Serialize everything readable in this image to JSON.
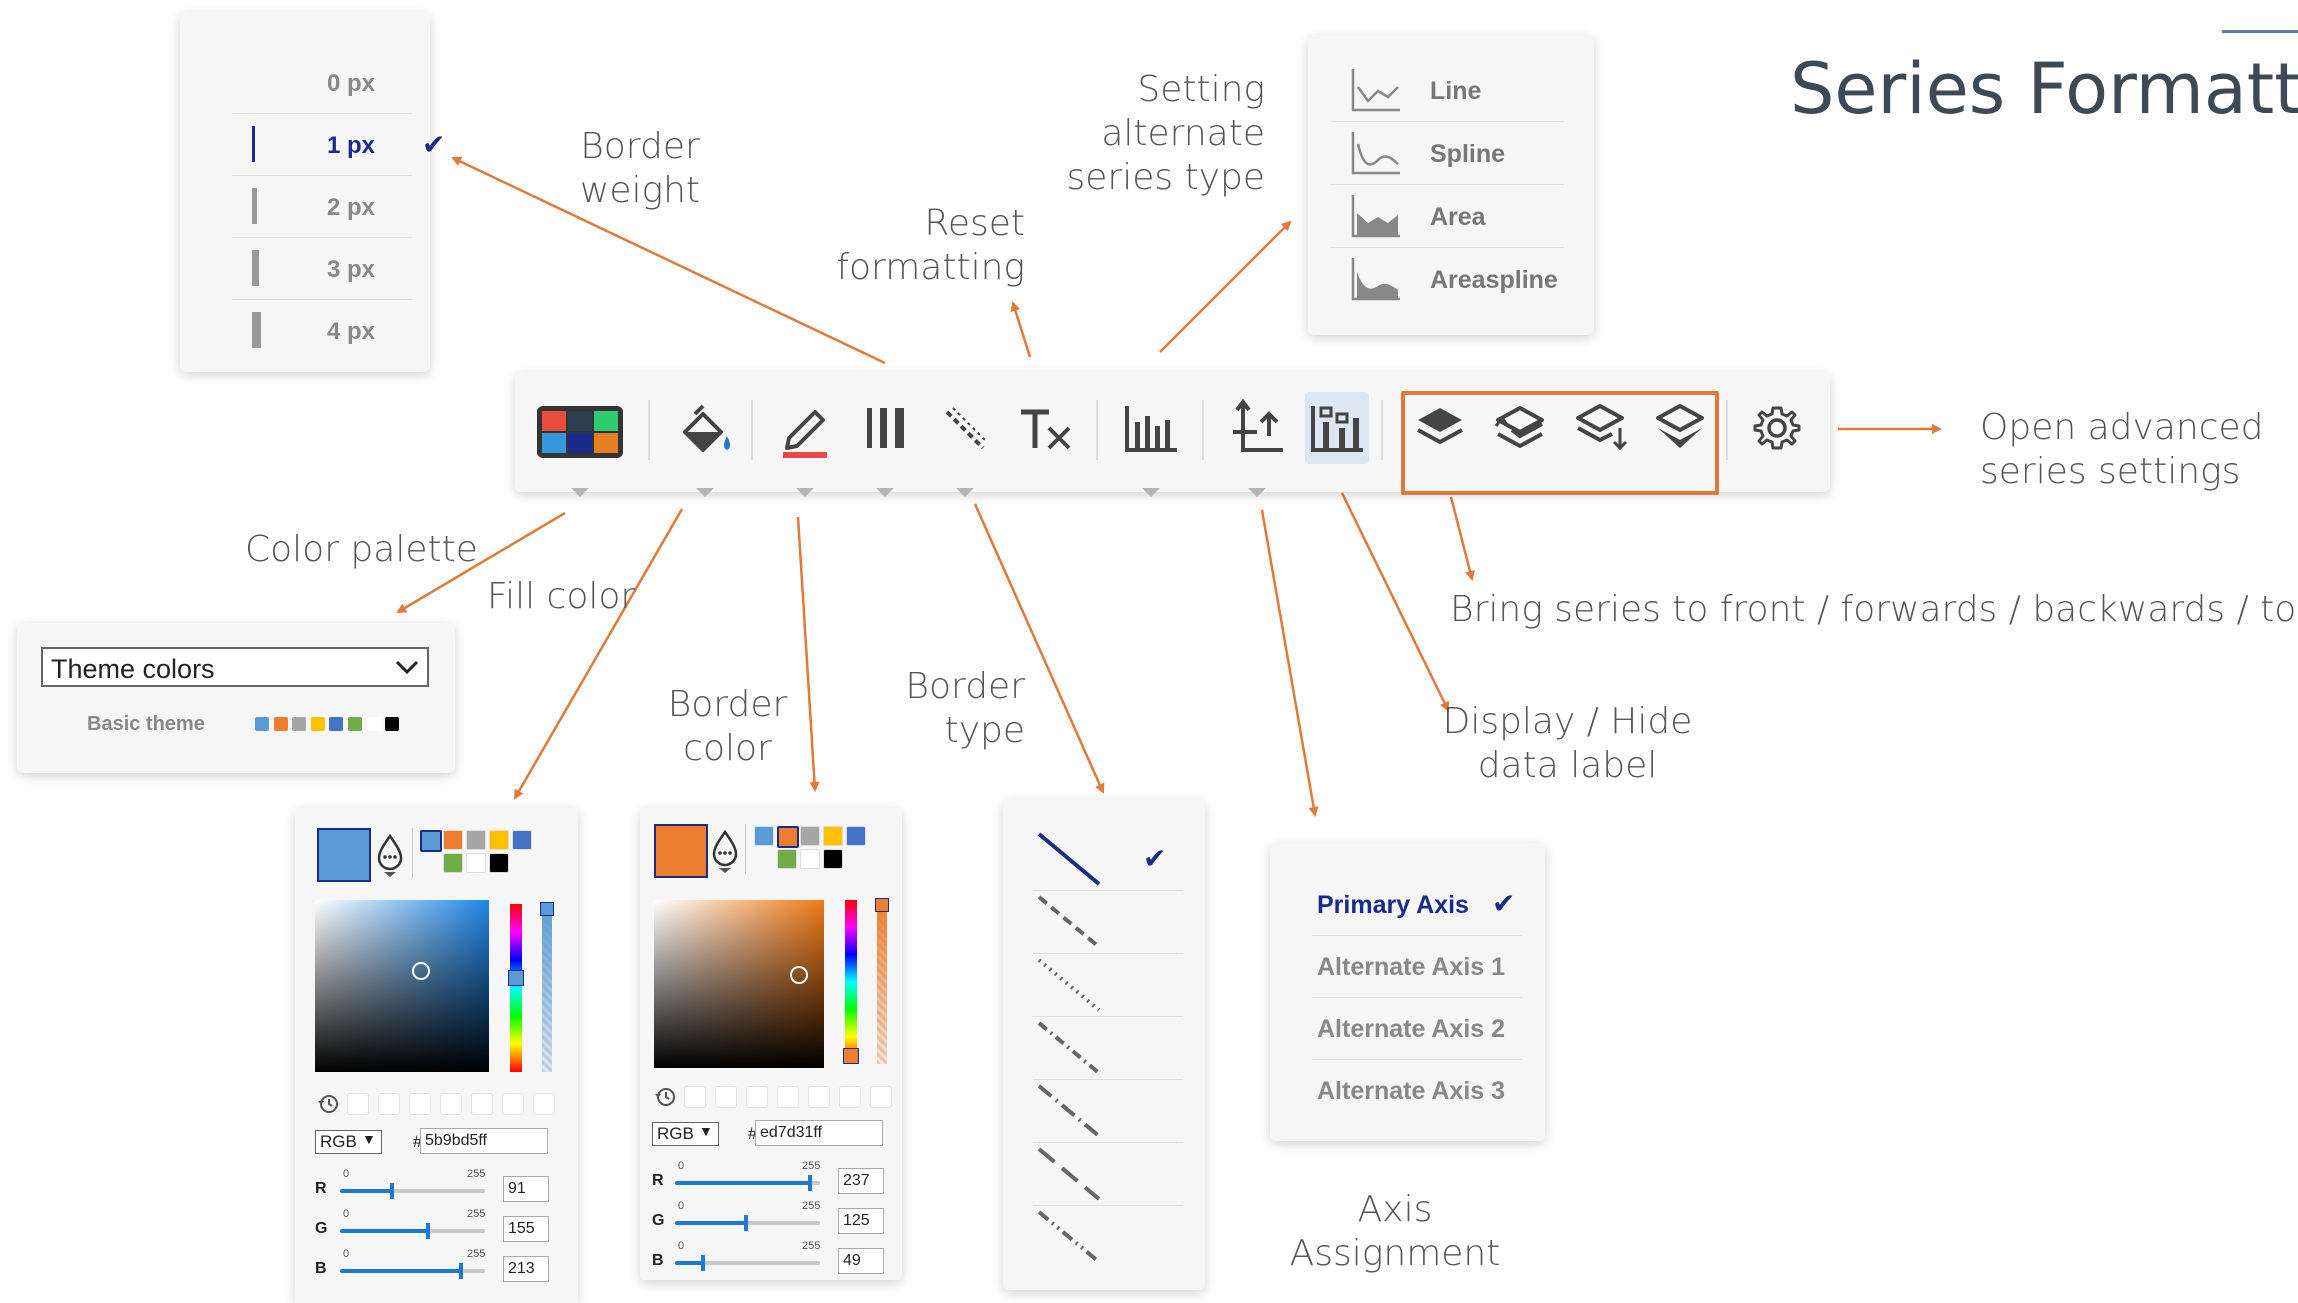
{
  "page_title": "Series Formattir",
  "annotations": {
    "border_weight": [
      "Border",
      "weight"
    ],
    "reset_formatting": [
      "Reset",
      "formatting"
    ],
    "alternate_series_type": [
      "Setting",
      "alternate",
      "series type"
    ],
    "open_advanced": [
      "Open advanced",
      "series settings"
    ],
    "color_palette": "Color palette",
    "fill_color": "Fill color",
    "border_color": [
      "Border",
      "color"
    ],
    "border_type": [
      "Border",
      "type"
    ],
    "series_order": "Bring series to front / forwards / backwards / to back",
    "data_label": [
      "Display / Hide",
      "data label"
    ],
    "axis_assignment": [
      "Axis",
      "Assignment"
    ]
  },
  "border_weight_menu": {
    "items": [
      "0 px",
      "1 px",
      "2 px",
      "3 px",
      "4 px"
    ],
    "selected": "1 px",
    "check": "✔"
  },
  "series_type_menu": {
    "items": [
      {
        "label": "Line",
        "icon": "line-chart-icon"
      },
      {
        "label": "Spline",
        "icon": "spline-chart-icon"
      },
      {
        "label": "Area",
        "icon": "area-chart-icon"
      },
      {
        "label": "Areaspline",
        "icon": "areaspline-chart-icon"
      }
    ]
  },
  "palette_panel": {
    "select_value": "Theme colors",
    "row_label": "Basic theme",
    "swatches": [
      "#5b9bd5",
      "#ed7d31",
      "#a5a5a5",
      "#ffc000",
      "#4472c4",
      "#70ad47",
      "#ffffff",
      "#000000"
    ]
  },
  "fill_picker": {
    "current_color": "#5b9bd5",
    "mode": "RGB",
    "hex": "5b9bd5",
    "max": "255",
    "min": "0",
    "r": "91",
    "g": "155",
    "b": "213",
    "r_label": "R",
    "g_label": "G",
    "b_label": "B",
    "hash": "#"
  },
  "border_picker": {
    "current_color": "#ed7d31",
    "mode": "RGB",
    "hex": "ed7d31ff",
    "max": "255",
    "min": "0",
    "r": "237",
    "g": "125",
    "b": "49",
    "r_label": "R",
    "g_label": "G",
    "b_label": "B",
    "hash": "#"
  },
  "fill_picker_hex": "5b9bd5ff",
  "border_type_menu": {
    "styles": [
      "solid",
      "dash",
      "dot",
      "dash-dot",
      "long-dash-dot",
      "long-dash",
      "dash-dot-dot"
    ],
    "selected": "solid",
    "check": "✔"
  },
  "axis_menu": {
    "items": [
      "Primary Axis",
      "Alternate Axis 1",
      "Alternate Axis 2",
      "Alternate Axis 3"
    ],
    "selected": "Primary Axis",
    "check": "✔"
  },
  "toolbar": {
    "buttons": [
      "color-palette-button",
      "fill-color-button",
      "border-color-button",
      "border-weight-button",
      "border-type-button",
      "reset-formatting-button",
      "series-type-button",
      "axis-assignment-button",
      "data-label-button",
      "bring-to-front-button",
      "bring-forwards-button",
      "send-backwards-button",
      "send-to-back-button",
      "advanced-settings-button"
    ]
  },
  "colors": {
    "accent_orange": "#e07a3a",
    "selection_blue": "#1a2b8a",
    "icon_gray": "#444444"
  }
}
